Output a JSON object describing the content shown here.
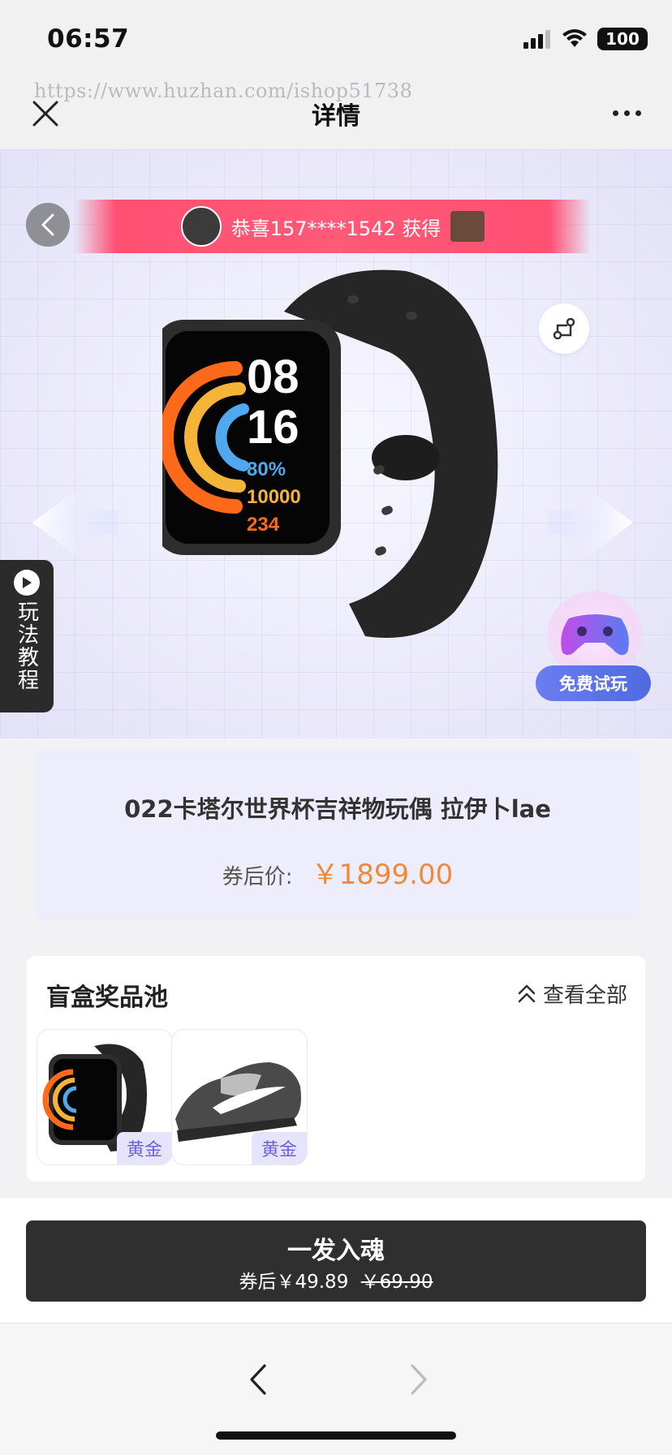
{
  "status_bar": {
    "time": "06:57",
    "battery": "100"
  },
  "nav": {
    "title": "详情",
    "watermark": "https://www.huzhan.com/ishop51738"
  },
  "hero": {
    "winner_banner": "恭喜157****1542 获得",
    "tutorial_label": "玩法教程",
    "trial_button": "免费试玩",
    "watch_face": {
      "hour": "08",
      "minute": "16",
      "battery": "80%",
      "steps": "10000",
      "calories": "234"
    }
  },
  "product": {
    "name": "022卡塔尔世界杯吉祥物玩偶 拉伊卜lae",
    "price_label": "券后价:",
    "price": "￥1899.00"
  },
  "prize_pool": {
    "title": "盲盒奖品池",
    "view_all": "查看全部",
    "items": [
      {
        "kind": "watch",
        "tag": "黄金"
      },
      {
        "kind": "sneaker",
        "tag": "黄金"
      }
    ]
  },
  "cta": {
    "label": "一发入魂",
    "coupon_price": "券后￥49.89",
    "original_price": "￥69.90"
  },
  "colors": {
    "price": "#ee8a3a",
    "banner": "#ff5a78",
    "tag_bg": "#e5e4fb",
    "tag_text": "#6d63d6",
    "cta_bg": "#2f2f2f"
  }
}
